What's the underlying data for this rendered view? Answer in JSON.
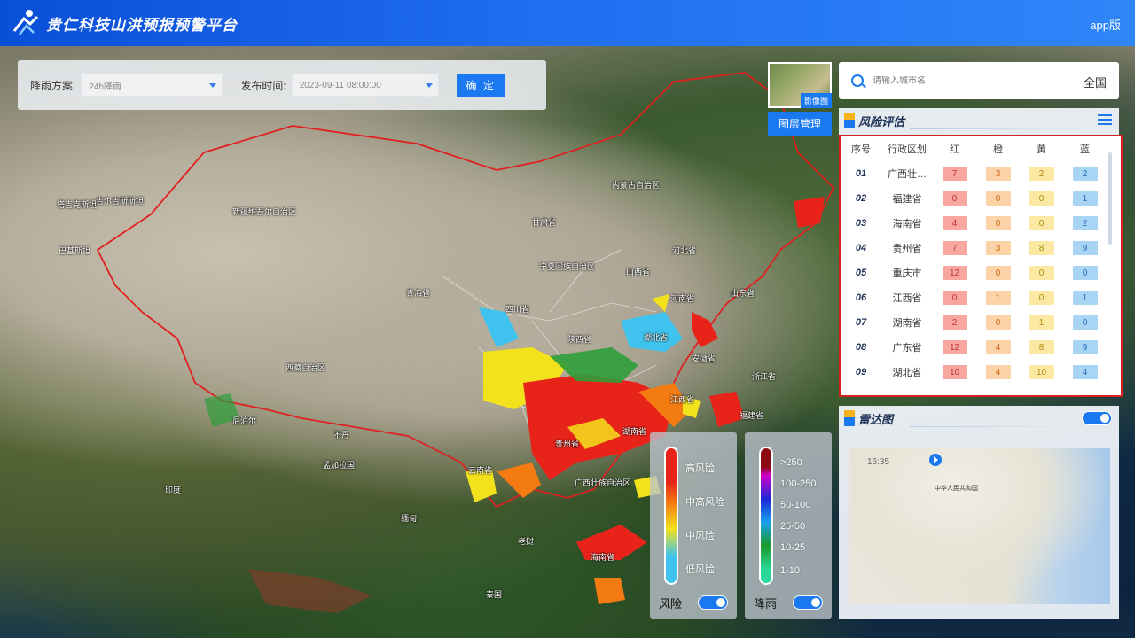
{
  "header": {
    "title": "贵仁科技山洪预报预警平台",
    "app_link": "app版"
  },
  "filter": {
    "scheme_label": "降雨方案:",
    "scheme_value": "24h降雨",
    "time_label": "发布时间:",
    "time_value": "2023-09-11 08:00:00",
    "confirm": "确 定"
  },
  "imagery": {
    "tag": "影像图",
    "layer_button": "图层管理"
  },
  "search": {
    "placeholder": "请输入城市名",
    "scope": "全国"
  },
  "risk": {
    "title": "风险评估",
    "headers": [
      "序号",
      "行政区划",
      "红",
      "橙",
      "黄",
      "蓝"
    ],
    "rows": [
      {
        "no": "01",
        "name": "广西壮…",
        "red": "7",
        "orange": "3",
        "yellow": "2",
        "blue": "2"
      },
      {
        "no": "02",
        "name": "福建省",
        "red": "0",
        "orange": "0",
        "yellow": "0",
        "blue": "1"
      },
      {
        "no": "03",
        "name": "海南省",
        "red": "4",
        "orange": "0",
        "yellow": "0",
        "blue": "2"
      },
      {
        "no": "04",
        "name": "贵州省",
        "red": "7",
        "orange": "3",
        "yellow": "8",
        "blue": "9"
      },
      {
        "no": "05",
        "name": "重庆市",
        "red": "12",
        "orange": "0",
        "yellow": "0",
        "blue": "0"
      },
      {
        "no": "06",
        "name": "江西省",
        "red": "0",
        "orange": "1",
        "yellow": "0",
        "blue": "1"
      },
      {
        "no": "07",
        "name": "湖南省",
        "red": "2",
        "orange": "0",
        "yellow": "1",
        "blue": "0"
      },
      {
        "no": "08",
        "name": "广东省",
        "red": "12",
        "orange": "4",
        "yellow": "8",
        "blue": "9"
      },
      {
        "no": "09",
        "name": "湖北省",
        "red": "10",
        "orange": "4",
        "yellow": "10",
        "blue": "4"
      }
    ]
  },
  "radar": {
    "title": "雷达图",
    "time": "16:35",
    "label_china": "中华人民共和国"
  },
  "legend_risk": {
    "items": [
      "高风险",
      "中高风险",
      "中风险",
      "低风险"
    ],
    "footer": "风险"
  },
  "legend_rain": {
    "items": [
      ">250",
      "100-250",
      "50-100",
      "25-50",
      "10-25",
      "1-10"
    ],
    "footer": "降雨"
  },
  "map_labels": {
    "l1": "吉尔吉斯斯坦",
    "l2": "塔吉克斯坦",
    "l3": "新疆维吾尔自治区",
    "l4": "巴基斯坦",
    "l5": "青海省",
    "l6": "西藏自治区",
    "l7": "宁夏回族自治区",
    "l8": "山西省",
    "l9": "河北省",
    "l10": "内蒙古自治区",
    "l11": "印度",
    "l12": "尼泊尔",
    "l13": "不丹",
    "l14": "孟加拉国",
    "l15": "缅甸",
    "l16": "泰国",
    "l17": "老挝",
    "l18": "广西壮族自治区",
    "l19": "湖北省",
    "l20": "湖南省",
    "l21": "贵州省",
    "l22": "陕西省",
    "l23": "河南省",
    "l24": "安徽省",
    "l25": "浙江省",
    "l26": "江西省",
    "l27": "福建省",
    "l28": "海南省",
    "l29": "云南省",
    "l30": "四川省",
    "l31": "甘肃省",
    "l32": "山东省"
  },
  "colors": {
    "accent": "#1a78f0",
    "risk_high": "#e8231a",
    "risk_midhigh": "#f47a12",
    "risk_mid": "#f2e21c",
    "risk_low": "#3fc3ee"
  }
}
